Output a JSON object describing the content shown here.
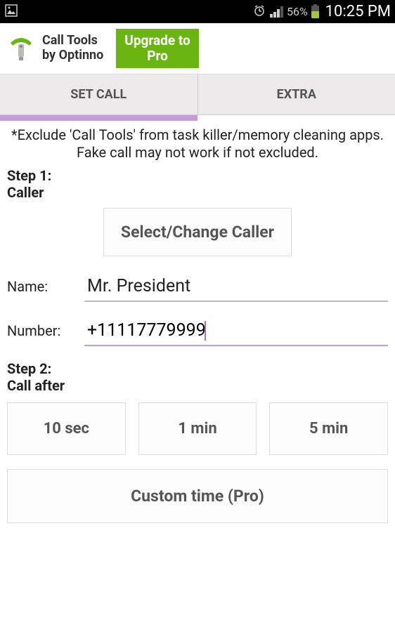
{
  "status": {
    "battery_pct": "56%",
    "time": "10:25 PM"
  },
  "header": {
    "app_name": "Call Tools",
    "app_by": "by Optinno",
    "upgrade_line1": "Upgrade to",
    "upgrade_line2": "Pro"
  },
  "tabs": {
    "set_call": "SET CALL",
    "extra": "EXTRA"
  },
  "notice": "*Exclude 'Call Tools' from task killer/memory cleaning apps. Fake call may not work if not excluded.",
  "step1": {
    "label_line1": "Step 1:",
    "label_line2": "Caller",
    "select_btn": "Select/Change Caller",
    "name_label": "Name:",
    "name_value": "Mr. President",
    "number_label": "Number:",
    "number_value": "+11117779999"
  },
  "step2": {
    "label_line1": "Step 2:",
    "label_line2": "Call after",
    "opt1": "10 sec",
    "opt2": "1 min",
    "opt3": "5 min",
    "custom": "Custom time (Pro)"
  }
}
